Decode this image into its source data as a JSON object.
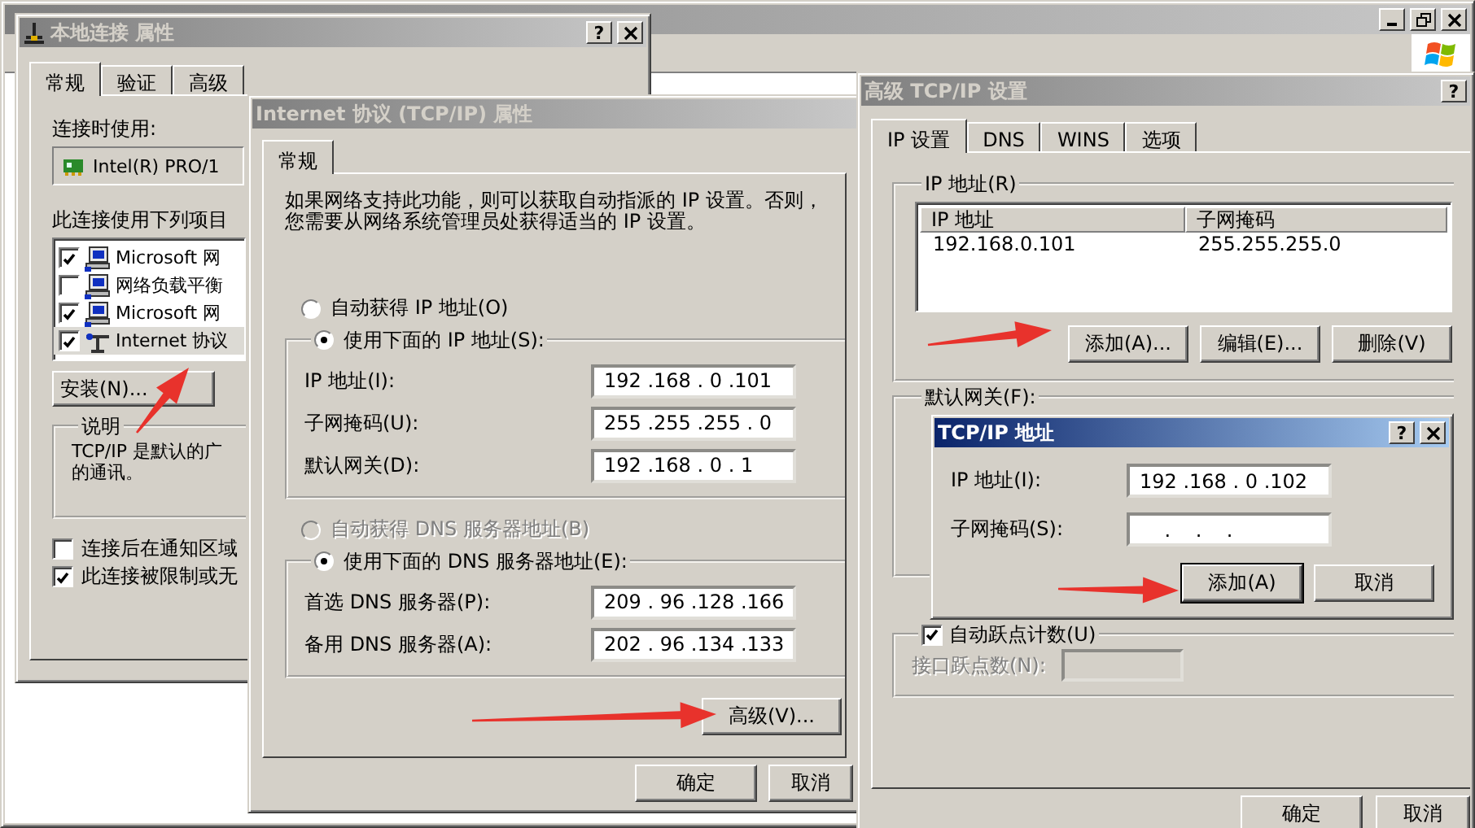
{
  "local_connection_dialog": {
    "title": "本地连接 属性",
    "active": false,
    "help_button": "?",
    "tabs": [
      {
        "label": "常规",
        "selected": true
      },
      {
        "label": "验证",
        "selected": false
      },
      {
        "label": "高级",
        "selected": false
      }
    ],
    "connect_using_label": "连接时使用:",
    "adapter": "Intel(R) PRO/1",
    "components_label": "此连接使用下列项目",
    "components": [
      {
        "name": "Microsoft 网",
        "kind": "client",
        "checked": true,
        "selected": false
      },
      {
        "name": "网络负载平衡",
        "kind": "client",
        "checked": false,
        "selected": false
      },
      {
        "name": "Microsoft 网",
        "kind": "client",
        "checked": true,
        "selected": false
      },
      {
        "name": "Internet 协议",
        "kind": "protocol",
        "checked": true,
        "selected": true
      }
    ],
    "install_button": "安装(N)...",
    "description": {
      "title": "说明",
      "lines": [
        "TCP/IP 是默认的广",
        "的通讯。"
      ]
    },
    "options": [
      {
        "label": "连接后在通知区域",
        "checked": false
      },
      {
        "label": "此连接被限制或无",
        "checked": true
      }
    ]
  },
  "tcpip_dialog": {
    "title": "Internet 协议 (TCP/IP) 属性",
    "active": false,
    "tabs": [
      {
        "label": "常规",
        "selected": true
      }
    ],
    "intro": [
      "如果网络支持此功能，则可以获取自动指派的 IP 设置。否则，",
      "您需要从网络系统管理员处获得适当的 IP 设置。"
    ],
    "ip_modes": [
      {
        "label": "自动获得 IP 地址(O)",
        "selected": false,
        "disabled": false
      },
      {
        "label": "使用下面的 IP 地址(S):",
        "selected": true,
        "disabled": false
      }
    ],
    "ip_fields": [
      {
        "label": "IP 地址(I):",
        "value": "192 .168 . 0 .101"
      },
      {
        "label": "子网掩码(U):",
        "value": "255 .255 .255 . 0"
      },
      {
        "label": "默认网关(D):",
        "value": "192 .168 . 0 . 1"
      }
    ],
    "dns_modes": [
      {
        "label": "自动获得 DNS 服务器地址(B)",
        "selected": false,
        "disabled": true
      },
      {
        "label": "使用下面的 DNS 服务器地址(E):",
        "selected": true,
        "disabled": false
      }
    ],
    "dns_fields": [
      {
        "label": "首选 DNS 服务器(P):",
        "value": "209 . 96 .128 .166"
      },
      {
        "label": "备用 DNS 服务器(A):",
        "value": "202 . 96 .134 .133"
      }
    ],
    "advanced_button": "高级(V)...",
    "buttons": [
      "确定",
      "取消"
    ]
  },
  "advanced_dialog": {
    "title": "高级 TCP/IP 设置",
    "active": false,
    "help_button": "?",
    "tabs": [
      {
        "label": "IP 设置",
        "selected": true
      },
      {
        "label": "DNS",
        "selected": false
      },
      {
        "label": "WINS",
        "selected": false
      },
      {
        "label": "选项",
        "selected": false
      }
    ],
    "ip_group": {
      "title": "IP 地址(R)",
      "columns": [
        "IP 地址",
        "子网掩码"
      ],
      "rows": [
        [
          "192.168.0.101",
          "255.255.255.0"
        ]
      ],
      "buttons": [
        "添加(A)...",
        "编辑(E)...",
        "删除(V)"
      ]
    },
    "gateway_group": {
      "title": "默认网关(F):"
    },
    "auto_metric": {
      "label": "自动跃点计数(U)",
      "checked": true
    },
    "interface_metric": {
      "label": "接口跃点数(N):",
      "disabled": true
    },
    "buttons": [
      "确定",
      "取消"
    ]
  },
  "address_dialog": {
    "title": "TCP/IP 地址",
    "active": true,
    "help_button": "?",
    "fields": [
      {
        "label": "IP 地址(I):",
        "value": "192 .168 . 0 .102"
      },
      {
        "label": "子网掩码(S):",
        "value": "    .    .    ."
      }
    ],
    "buttons": [
      {
        "label": "添加(A)",
        "default": true
      },
      {
        "label": "取消",
        "default": false
      }
    ]
  }
}
